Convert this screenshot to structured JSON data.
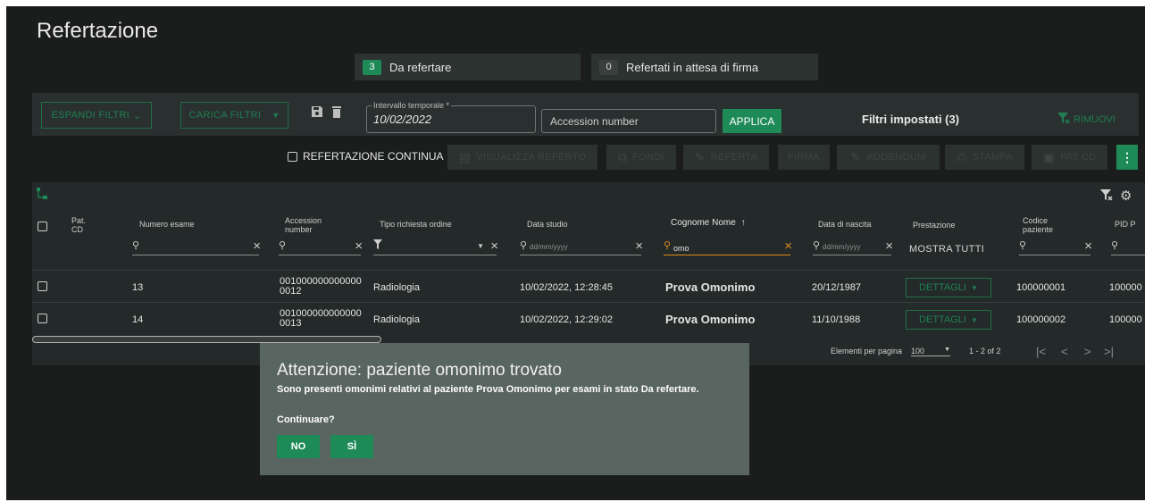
{
  "page": {
    "title": "Refertazione"
  },
  "counters": [
    {
      "count": "3",
      "label": "Da refertare"
    },
    {
      "count": "0",
      "label": "Refertati in attesa di firma"
    }
  ],
  "filters": {
    "expand_label": "ESPANDI FILTRI",
    "load_label": "CARICA FILTRI",
    "interval_label": "Intervallo temporale *",
    "interval_value": "10/02/2022",
    "accession_placeholder": "Accession number",
    "apply_label": "APPLICA",
    "set_filters": "Filtri impostati (3)",
    "remove_label": "RIMUOVI"
  },
  "actions": {
    "continuous_label": "REFERTAZIONE CONTINUA",
    "view_report": "VISUALIZZA REFERTO",
    "merge": "FONDI",
    "report": "REFERTA",
    "sign": "FIRMA",
    "addendum": "ADDENDUM",
    "print": "STAMPA",
    "patcd": "PAT CD",
    "more": "⋮"
  },
  "table": {
    "headers": {
      "patcd": "Pat. CD",
      "numero": "Numero esame",
      "accession": "Accession number",
      "tipo": "Tipo richiesta ordine",
      "data_studio": "Data studio",
      "cognome": "Cognome Nome",
      "nascita": "Data di nascita",
      "prestazione": "Prestazione",
      "codice": "Codice paziente",
      "pid": "PID P"
    },
    "filters": {
      "date_placeholder": "dd/mm/yyyy",
      "name_value": "omo",
      "show_all": "MOSTRA TUTTI"
    },
    "rows": [
      {
        "numero": "13",
        "accession_line1": "001000000000000",
        "accession_line2": "0012",
        "tipo": "Radiologia",
        "data_studio": "10/02/2022, 12:28:45",
        "cognome": "Prova Omonimo",
        "nascita": "20/12/1987",
        "prestazione": "DETTAGLI",
        "codice": "100000001",
        "pid": "100000"
      },
      {
        "numero": "14",
        "accession_line1": "001000000000000",
        "accession_line2": "0013",
        "tipo": "Radiologia",
        "data_studio": "10/02/2022, 12:29:02",
        "cognome": "Prova Omonimo",
        "nascita": "11/10/1988",
        "prestazione": "DETTAGLI",
        "codice": "100000002",
        "pid": "100000"
      }
    ],
    "paginator": {
      "label": "Elementi per pagina",
      "size": "100",
      "range": "1 - 2 of 2"
    }
  },
  "dialog": {
    "title": "Attenzione: paziente omonimo trovato",
    "message": "Sono presenti omonimi relativi al paziente Prova Omonimo per esami in stato Da refertare.",
    "question": "Continuare?",
    "no_label": "NO",
    "yes_label": "SÌ"
  },
  "colors": {
    "accent": "#1e8a57",
    "background": "#1b1d1d",
    "dialog": "#596561",
    "warning": "#e08a1e"
  }
}
